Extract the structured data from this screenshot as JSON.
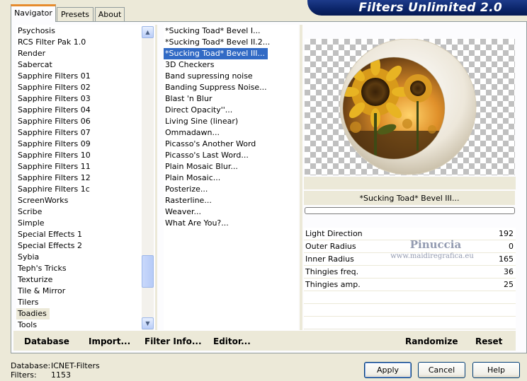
{
  "tabs": [
    {
      "label": "Navigator"
    },
    {
      "label": "Presets"
    },
    {
      "label": "About"
    }
  ],
  "app_title": "Filters Unlimited 2.0",
  "categories": [
    "Psychosis",
    "RCS Filter Pak 1.0",
    "Render",
    "Sabercat",
    "Sapphire Filters 01",
    "Sapphire Filters 02",
    "Sapphire Filters 03",
    "Sapphire Filters 04",
    "Sapphire Filters 06",
    "Sapphire Filters 07",
    "Sapphire Filters 09",
    "Sapphire Filters 10",
    "Sapphire Filters 11",
    "Sapphire Filters 12",
    "Sapphire Filters 1c",
    "ScreenWorks",
    "Scribe",
    "Simple",
    "Special Effects 1",
    "Special Effects 2",
    "Sybia",
    "Teph's Tricks",
    "Texturize",
    "Tile & Mirror",
    "Tilers",
    "Toadies",
    "Tools"
  ],
  "selected_category": "Toadies",
  "filters": [
    "*Sucking Toad*  Bevel I...",
    "*Sucking Toad*  Bevel II.2...",
    "*Sucking Toad*  Bevel III...",
    "3D Checkers",
    "Band supressing noise",
    "Banding Suppress Noise...",
    "Blast 'n Blur",
    "Direct Opacity''...",
    "Living Sine (linear)",
    "Ommadawn...",
    "Picasso's Another Word",
    "Picasso's Last Word...",
    "Plain Mosaic Blur...",
    "Plain Mosaic...",
    "Posterize...",
    "Rasterline...",
    "Weaver...",
    "What Are You?..."
  ],
  "selected_filter": "*Sucking Toad*  Bevel III...",
  "preview_filter_title": "*Sucking Toad*  Bevel III...",
  "progress": 0,
  "parameters": [
    {
      "label": "Light Direction",
      "value": "192"
    },
    {
      "label": "Outer Radius",
      "value": "0"
    },
    {
      "label": "Inner Radius",
      "value": "165"
    },
    {
      "label": "Thingies freq.",
      "value": "36"
    },
    {
      "label": "Thingies amp.",
      "value": "25"
    }
  ],
  "watermark": {
    "line1": "Pinuccia",
    "line2": "www.maidiregrafica.eu"
  },
  "bottom_buttons": {
    "database": "Database",
    "import": "Import...",
    "filter_info": "Filter Info...",
    "editor": "Editor...",
    "randomize": "Randomize",
    "reset": "Reset"
  },
  "status": {
    "database_label": "Database:",
    "database_value": "ICNET-Filters",
    "filters_label": "Filters:",
    "filters_value": "1153"
  },
  "dialog_buttons": {
    "apply": "Apply",
    "cancel": "Cancel",
    "help": "Help"
  },
  "colors": {
    "selection_blue": "#316ac5",
    "banner_blue": "#0b2468",
    "tab_accent": "#e68b2c"
  },
  "icons": {
    "scroll_up": "scroll-up-arrow-icon",
    "scroll_down": "scroll-down-arrow-icon"
  }
}
